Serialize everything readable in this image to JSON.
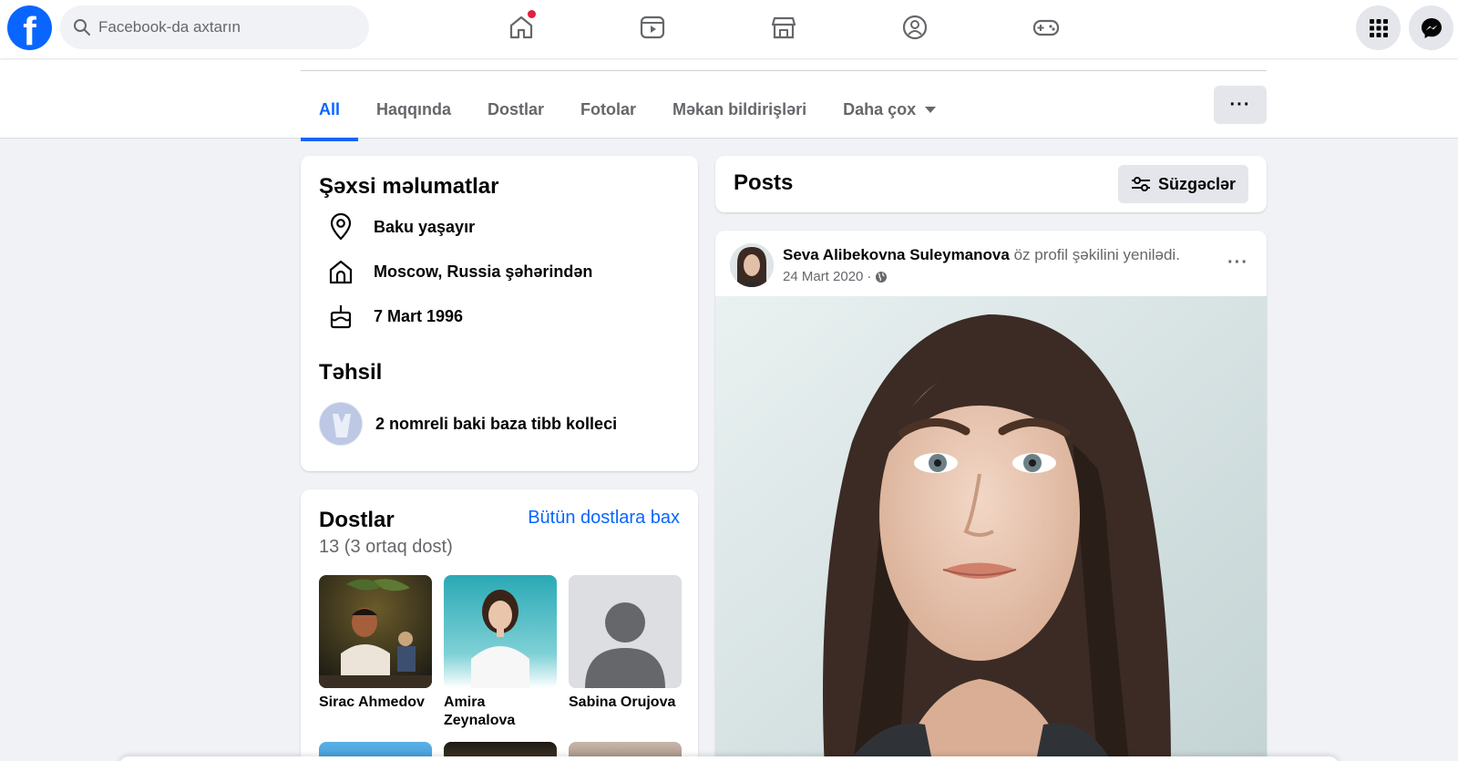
{
  "topbar": {
    "logo_letter": "f",
    "search_placeholder": "Facebook-da axtarın",
    "nav": [
      {
        "name": "home",
        "has_notification": true
      },
      {
        "name": "video"
      },
      {
        "name": "marketplace"
      },
      {
        "name": "groups"
      },
      {
        "name": "gaming"
      }
    ]
  },
  "profile_tabs": {
    "items": [
      {
        "label": "All",
        "active": true
      },
      {
        "label": "Haqqında"
      },
      {
        "label": "Dostlar"
      },
      {
        "label": "Fotolar"
      },
      {
        "label": "Məkan bildirişləri"
      },
      {
        "label": "Daha çox"
      }
    ],
    "more_button_label": "···"
  },
  "personal_info": {
    "title": "Şəxsi məlumatlar",
    "items": [
      {
        "icon": "location-pin-icon",
        "text": "Baku yaşayır"
      },
      {
        "icon": "home-icon",
        "text": "Moscow, Russia şəhərindən"
      },
      {
        "icon": "birthday-cake-icon",
        "text": "7 Mart 1996"
      }
    ],
    "education_title": "Təhsil",
    "education_item": "2 nomreli baki baza tibb kolleci"
  },
  "friends": {
    "title": "Dostlar",
    "see_all": "Bütün dostlara bax",
    "count": "13 (3 ortaq dost)",
    "list": [
      {
        "name": "Sirac Ahmedov"
      },
      {
        "name": "Amira Zeynalova"
      },
      {
        "name": "Sabina Orujova"
      }
    ]
  },
  "posts": {
    "title": "Posts",
    "filters_label": "Süzgəclər",
    "post": {
      "author": "Seva Alibekovna Suleymanova",
      "action": "öz profil şəkilini yenilədi.",
      "date": "24 Mart 2020",
      "separator": "·",
      "menu": "···"
    }
  },
  "colors": {
    "brand": "#0866ff",
    "notification": "#e41e3f",
    "page_bg": "#f0f2f5",
    "secondary_text": "#65676b"
  }
}
